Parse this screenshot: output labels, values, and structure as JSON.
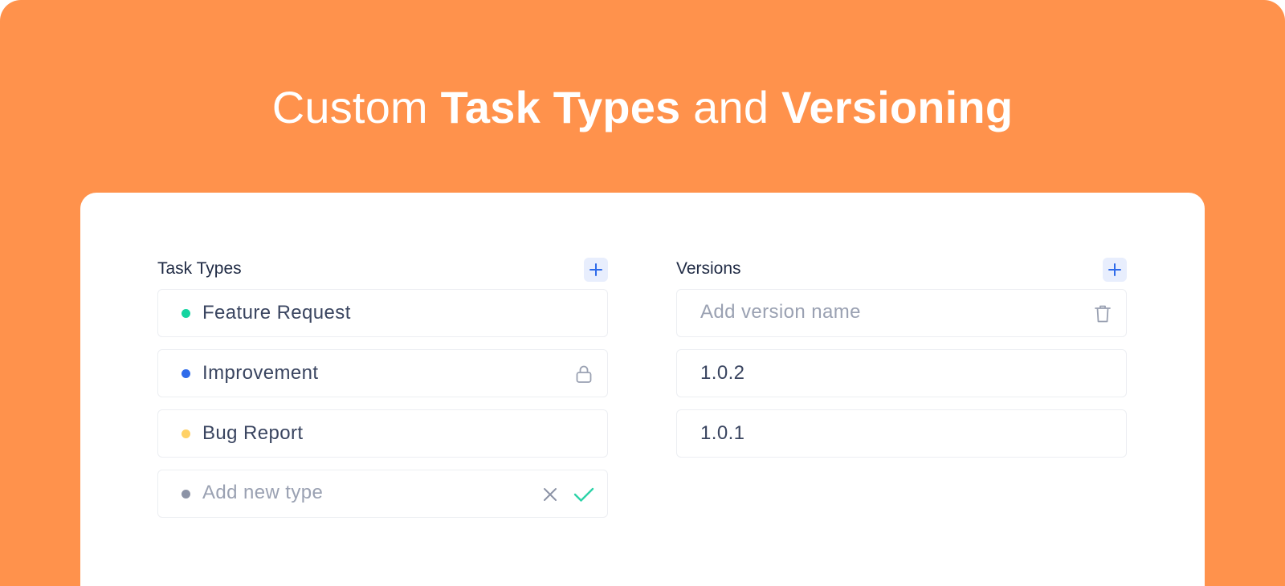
{
  "headline": {
    "part1": "Custom ",
    "part2": "Task Types",
    "part3": " and ",
    "part4": "Versioning"
  },
  "colors": {
    "background": "#FF924C",
    "card": "#FFFFFF",
    "accent": "#2F6BEA",
    "confirm": "#2ED3A8"
  },
  "task_types": {
    "title": "Task Types",
    "add_icon": "plus-icon",
    "items": [
      {
        "label": "Feature Request",
        "color": "#14D4A0"
      },
      {
        "label": "Improvement",
        "color": "#2F6BEA",
        "icon": "lock-icon"
      },
      {
        "label": "Bug Report",
        "color": "#FFD166"
      }
    ],
    "new_type": {
      "placeholder": "Add new type",
      "color": "#8C93A6",
      "cancel_icon": "close-icon",
      "confirm_icon": "check-icon"
    }
  },
  "versions": {
    "title": "Versions",
    "add_icon": "plus-icon",
    "new_version": {
      "placeholder": "Add version name",
      "delete_icon": "trash-icon"
    },
    "items": [
      {
        "label": "1.0.2"
      },
      {
        "label": "1.0.1"
      }
    ]
  }
}
